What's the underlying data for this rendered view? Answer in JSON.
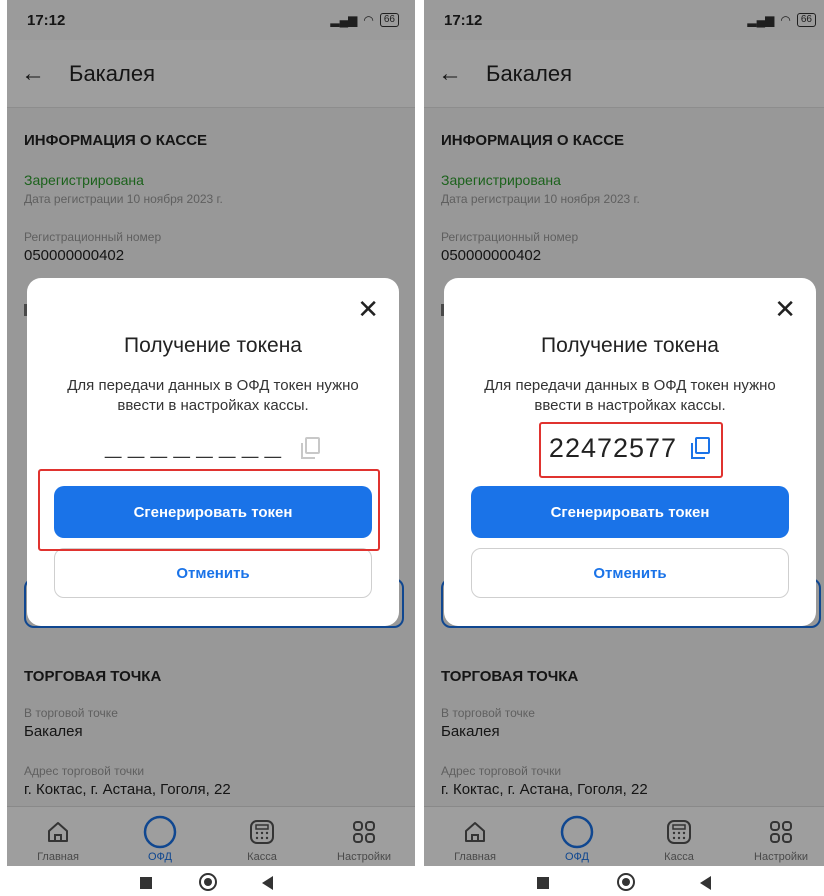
{
  "screens": [
    {
      "status": {
        "time": "17:12",
        "battery": "66"
      },
      "appbar": {
        "title": "Бакалея"
      },
      "cash_info": {
        "section_title": "ИНФОРМАЦИЯ О КАССЕ",
        "status": "Зарегистрирована",
        "registration_date": "Дата регистрации 10 ноября 2023 г.",
        "reg_number_label": "Регистрационный номер",
        "reg_number": "050000000402"
      },
      "store": {
        "section_title": "ТОРГОВАЯ ТОЧКА",
        "store_label": "В торговой точке",
        "store_value": "Бакалея",
        "address_label": "Адрес торговой точки",
        "address_value": "г. Коктас, г. Астана, Гоголя, 22"
      },
      "dialog": {
        "title": "Получение токена",
        "text": "Для передачи данных в ОФД токен нужно ввести в настройках кассы.",
        "token_placeholder": "________",
        "token_value": "",
        "generate_label": "Сгенерировать токен",
        "cancel_label": "Отменить"
      },
      "nav": [
        "Главная",
        "ОФД",
        "Касса",
        "Настройки"
      ]
    },
    {
      "status": {
        "time": "17:12",
        "battery": "66"
      },
      "appbar": {
        "title": "Бакалея"
      },
      "cash_info": {
        "section_title": "ИНФОРМАЦИЯ О КАССЕ",
        "status": "Зарегистрирована",
        "registration_date": "Дата регистрации 10 ноября 2023 г.",
        "reg_number_label": "Регистрационный номер",
        "reg_number": "050000000402"
      },
      "store": {
        "section_title": "ТОРГОВАЯ ТОЧКА",
        "store_label": "В торговой точке",
        "store_value": "Бакалея",
        "address_label": "Адрес торговой точки",
        "address_value": "г. Коктас, г. Астана, Гоголя, 22"
      },
      "dialog": {
        "title": "Получение токена",
        "text": "Для передачи данных в ОФД токен нужно ввести в настройках кассы.",
        "token_placeholder": "",
        "token_value": "22472577",
        "generate_label": "Сгенерировать токен",
        "cancel_label": "Отменить"
      },
      "nav": [
        "Главная",
        "ОФД",
        "Касса",
        "Настройки"
      ]
    }
  ],
  "colors": {
    "accent": "#1a73e8",
    "status_ok": "#2e9e2e",
    "highlight": "#e0332f"
  }
}
